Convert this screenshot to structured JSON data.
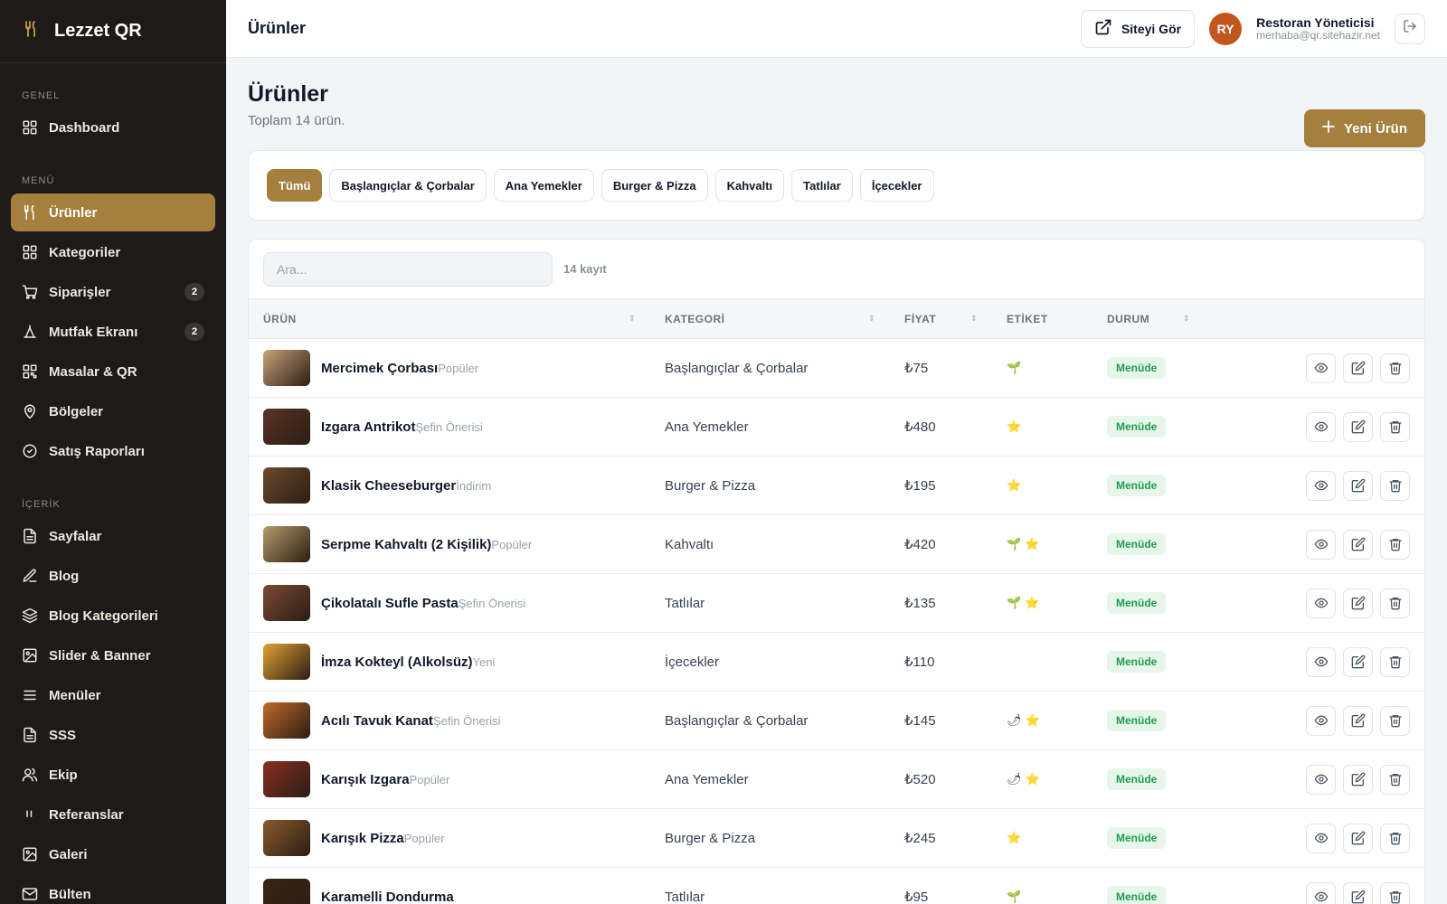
{
  "brand": {
    "name": "Lezzet QR",
    "icon": "fork-knife-icon"
  },
  "sidebar": {
    "sections": [
      {
        "label": "GENEL",
        "items": [
          {
            "label": "Dashboard",
            "icon": "dashboard-icon",
            "active": false,
            "badge": ""
          }
        ]
      },
      {
        "label": "MENÜ",
        "items": [
          {
            "label": "Ürünler",
            "icon": "fork-knife-icon",
            "active": true,
            "badge": ""
          },
          {
            "label": "Kategoriler",
            "icon": "grid-icon",
            "active": false,
            "badge": ""
          },
          {
            "label": "Siparişler",
            "icon": "cart-icon",
            "active": false,
            "badge": "2"
          },
          {
            "label": "Mutfak Ekranı",
            "icon": "chef-icon",
            "active": false,
            "badge": "2"
          },
          {
            "label": "Masalar & QR",
            "icon": "qr-icon",
            "active": false,
            "badge": ""
          },
          {
            "label": "Bölgeler",
            "icon": "map-pin-icon",
            "active": false,
            "badge": ""
          },
          {
            "label": "Satış Raporları",
            "icon": "chart-icon",
            "active": false,
            "badge": ""
          }
        ]
      },
      {
        "label": "İÇERİK",
        "items": [
          {
            "label": "Sayfalar",
            "icon": "file-icon",
            "active": false,
            "badge": ""
          },
          {
            "label": "Blog",
            "icon": "edit-icon",
            "active": false,
            "badge": ""
          },
          {
            "label": "Blog Kategorileri",
            "icon": "layers-icon",
            "active": false,
            "badge": ""
          },
          {
            "label": "Slider & Banner",
            "icon": "image-icon",
            "active": false,
            "badge": ""
          },
          {
            "label": "Menüler",
            "icon": "menu-icon",
            "active": false,
            "badge": ""
          },
          {
            "label": "SSS",
            "icon": "file-icon",
            "active": false,
            "badge": ""
          },
          {
            "label": "Ekip",
            "icon": "users-icon",
            "active": false,
            "badge": ""
          },
          {
            "label": "Referanslar",
            "icon": "quote-icon",
            "active": false,
            "badge": ""
          },
          {
            "label": "Galeri",
            "icon": "image-icon",
            "active": false,
            "badge": ""
          },
          {
            "label": "Bülten",
            "icon": "mail-icon",
            "active": false,
            "badge": ""
          }
        ]
      }
    ]
  },
  "header": {
    "title": "Ürünler",
    "view_site_label": "Siteyi Gör",
    "user": {
      "initials": "RY",
      "name": "Restoran Yöneticisi",
      "email": "merhaba@qr.sitehazir.net"
    }
  },
  "page": {
    "title": "Ürünler",
    "subtitle": "Toplam 14 ürün.",
    "new_button_label": "Yeni Ürün"
  },
  "filters": [
    {
      "label": "Tümü",
      "active": true
    },
    {
      "label": "Başlangıçlar & Çorbalar",
      "active": false
    },
    {
      "label": "Ana Yemekler",
      "active": false
    },
    {
      "label": "Burger & Pizza",
      "active": false
    },
    {
      "label": "Kahvaltı",
      "active": false
    },
    {
      "label": "Tatlılar",
      "active": false
    },
    {
      "label": "İçecekler",
      "active": false
    }
  ],
  "table": {
    "search_placeholder": "Ara...",
    "record_count": "14 kayıt",
    "columns": [
      "ÜRÜN",
      "KATEGORİ",
      "FİYAT",
      "ETİKET",
      "DURUM"
    ],
    "rows": [
      {
        "name": "Mercimek Çorbası",
        "badge": "Popüler",
        "category": "Başlangıçlar & Çorbalar",
        "price": "₺75",
        "tags": [
          "🌱"
        ],
        "status": "Menüde",
        "thumb_color": "#c9a27a"
      },
      {
        "name": "Izgara Antrikot",
        "badge": "Şefin Önerisi",
        "category": "Ana Yemekler",
        "price": "₺480",
        "tags": [
          "⭐"
        ],
        "status": "Menüde",
        "thumb_color": "#5a3324"
      },
      {
        "name": "Klasik Cheeseburger",
        "badge": "İndirim",
        "category": "Burger & Pizza",
        "price": "₺195",
        "tags": [
          "⭐"
        ],
        "status": "Menüde",
        "thumb_color": "#6b4a2b"
      },
      {
        "name": "Serpme Kahvaltı (2 Kişilik)",
        "badge": "Popüler",
        "category": "Kahvaltı",
        "price": "₺420",
        "tags": [
          "🌱",
          "⭐"
        ],
        "status": "Menüde",
        "thumb_color": "#b59a6a"
      },
      {
        "name": "Çikolatalı Sufle Pasta",
        "badge": "Şefin Önerisi",
        "category": "Tatlılar",
        "price": "₺135",
        "tags": [
          "🌱",
          "⭐"
        ],
        "status": "Menüde",
        "thumb_color": "#7a4b33"
      },
      {
        "name": "İmza Kokteyl (Alkolsüz)",
        "badge": "Yeni",
        "category": "İçecekler",
        "price": "₺110",
        "tags": [],
        "status": "Menüde",
        "thumb_color": "#e0a233"
      },
      {
        "name": "Acılı Tavuk Kanat",
        "badge": "Şefin Önerisi",
        "category": "Başlangıçlar & Çorbalar",
        "price": "₺145",
        "tags": [
          "🌶",
          "⭐"
        ],
        "status": "Menüde",
        "thumb_color": "#c06a2a"
      },
      {
        "name": "Karışık Izgara",
        "badge": "Popüler",
        "category": "Ana Yemekler",
        "price": "₺520",
        "tags": [
          "🌶",
          "⭐"
        ],
        "status": "Menüde",
        "thumb_color": "#8a2f22"
      },
      {
        "name": "Karışık Pizza",
        "badge": "Popüler",
        "category": "Burger & Pizza",
        "price": "₺245",
        "tags": [
          "⭐"
        ],
        "status": "Menüde",
        "thumb_color": "#8a5a2c"
      },
      {
        "name": "Karamelli Dondurma",
        "badge": "",
        "category": "Tatlılar",
        "price": "₺95",
        "tags": [
          "🌱"
        ],
        "status": "Menüde",
        "thumb_color": "#3a2416"
      }
    ]
  },
  "colors": {
    "accent": "#a57f3d",
    "sidebar_bg": "#1c1b19",
    "status_green": "#1f9d4c"
  }
}
